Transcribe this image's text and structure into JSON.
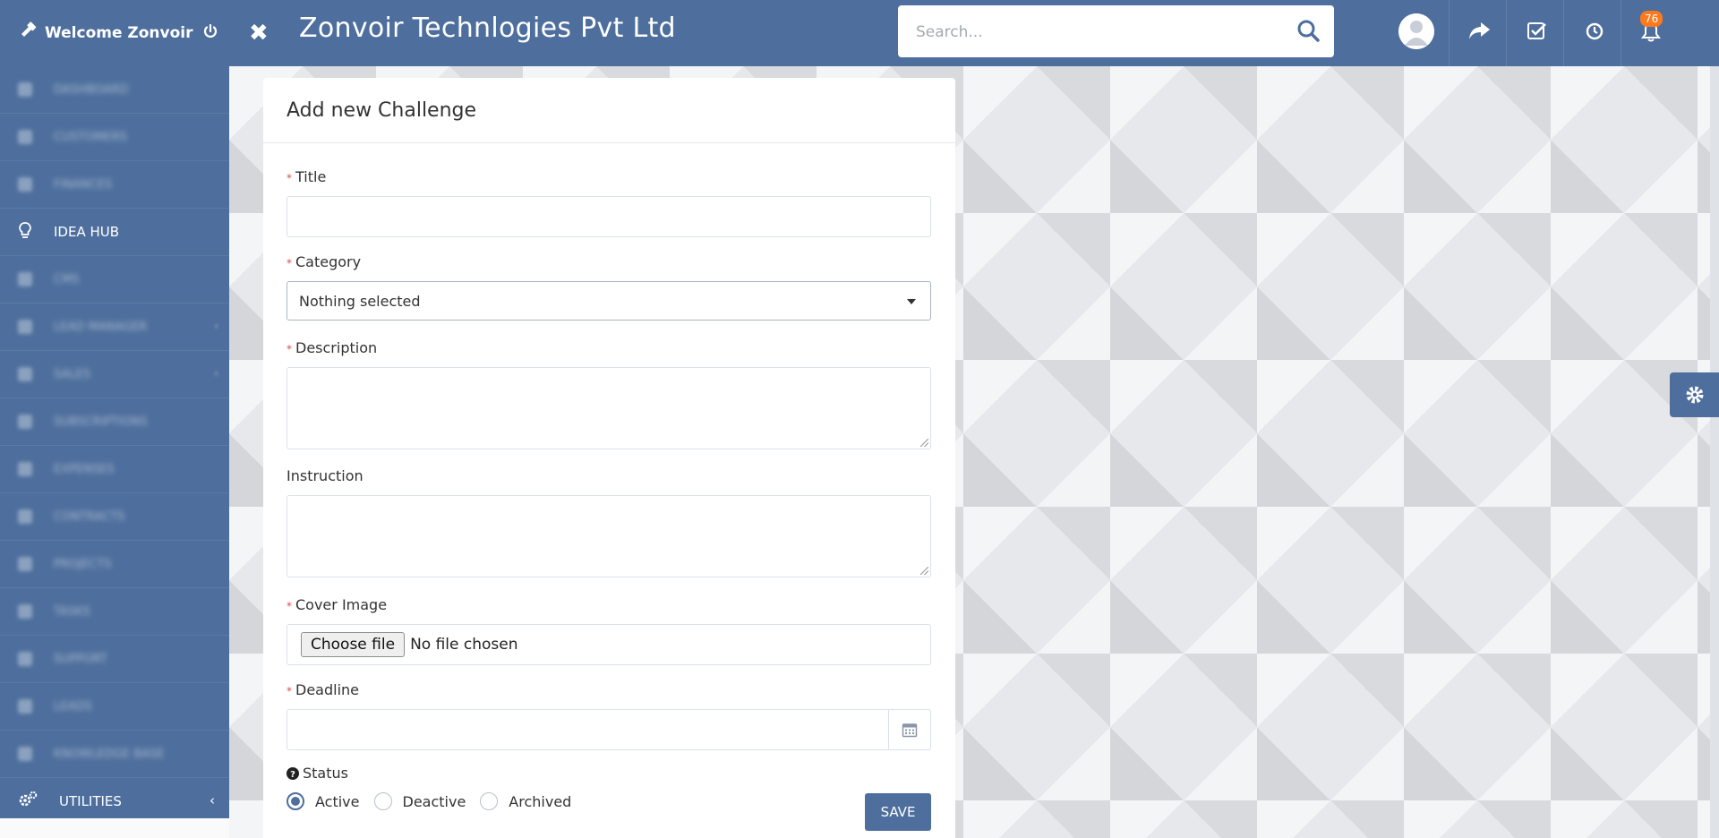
{
  "brand": {
    "welcome": "Welcome Zonvoir"
  },
  "header": {
    "company": "Zonvoir Technlogies Pvt Ltd",
    "search_placeholder": "Search...",
    "notification_count": "76"
  },
  "sidebar": {
    "items": [
      {
        "label": "Dashboard",
        "blurred": true
      },
      {
        "label": "Customers",
        "blurred": true
      },
      {
        "label": "Finances",
        "blurred": true
      },
      {
        "label": "IDEA HUB",
        "blurred": false
      },
      {
        "label": "CMS",
        "blurred": true
      },
      {
        "label": "Lead Manager",
        "blurred": true
      },
      {
        "label": "Sales",
        "blurred": true
      },
      {
        "label": "Subscriptions",
        "blurred": true
      },
      {
        "label": "Expenses",
        "blurred": true
      },
      {
        "label": "Contracts",
        "blurred": true
      },
      {
        "label": "Projects",
        "blurred": true
      },
      {
        "label": "Tasks",
        "blurred": true
      },
      {
        "label": "Support",
        "blurred": true
      },
      {
        "label": "Leads",
        "blurred": true
      },
      {
        "label": "Knowledge Base",
        "blurred": true
      }
    ],
    "utilities": "UTILITIES"
  },
  "form": {
    "heading": "Add new Challenge",
    "title_label": "Title",
    "category_label": "Category",
    "category_value": "Nothing selected",
    "description_label": "Description",
    "instruction_label": "Instruction",
    "cover_label": "Cover Image",
    "file_button": "Choose file",
    "file_status": "No file chosen",
    "deadline_label": "Deadline",
    "status_label": "Status",
    "status_options": [
      "Active",
      "Deactive",
      "Archived"
    ],
    "status_selected": "Active",
    "save": "SAVE"
  },
  "colors": {
    "primary": "#4e6f9d",
    "badge": "#fc7a1e",
    "required": "#e04a4a"
  }
}
